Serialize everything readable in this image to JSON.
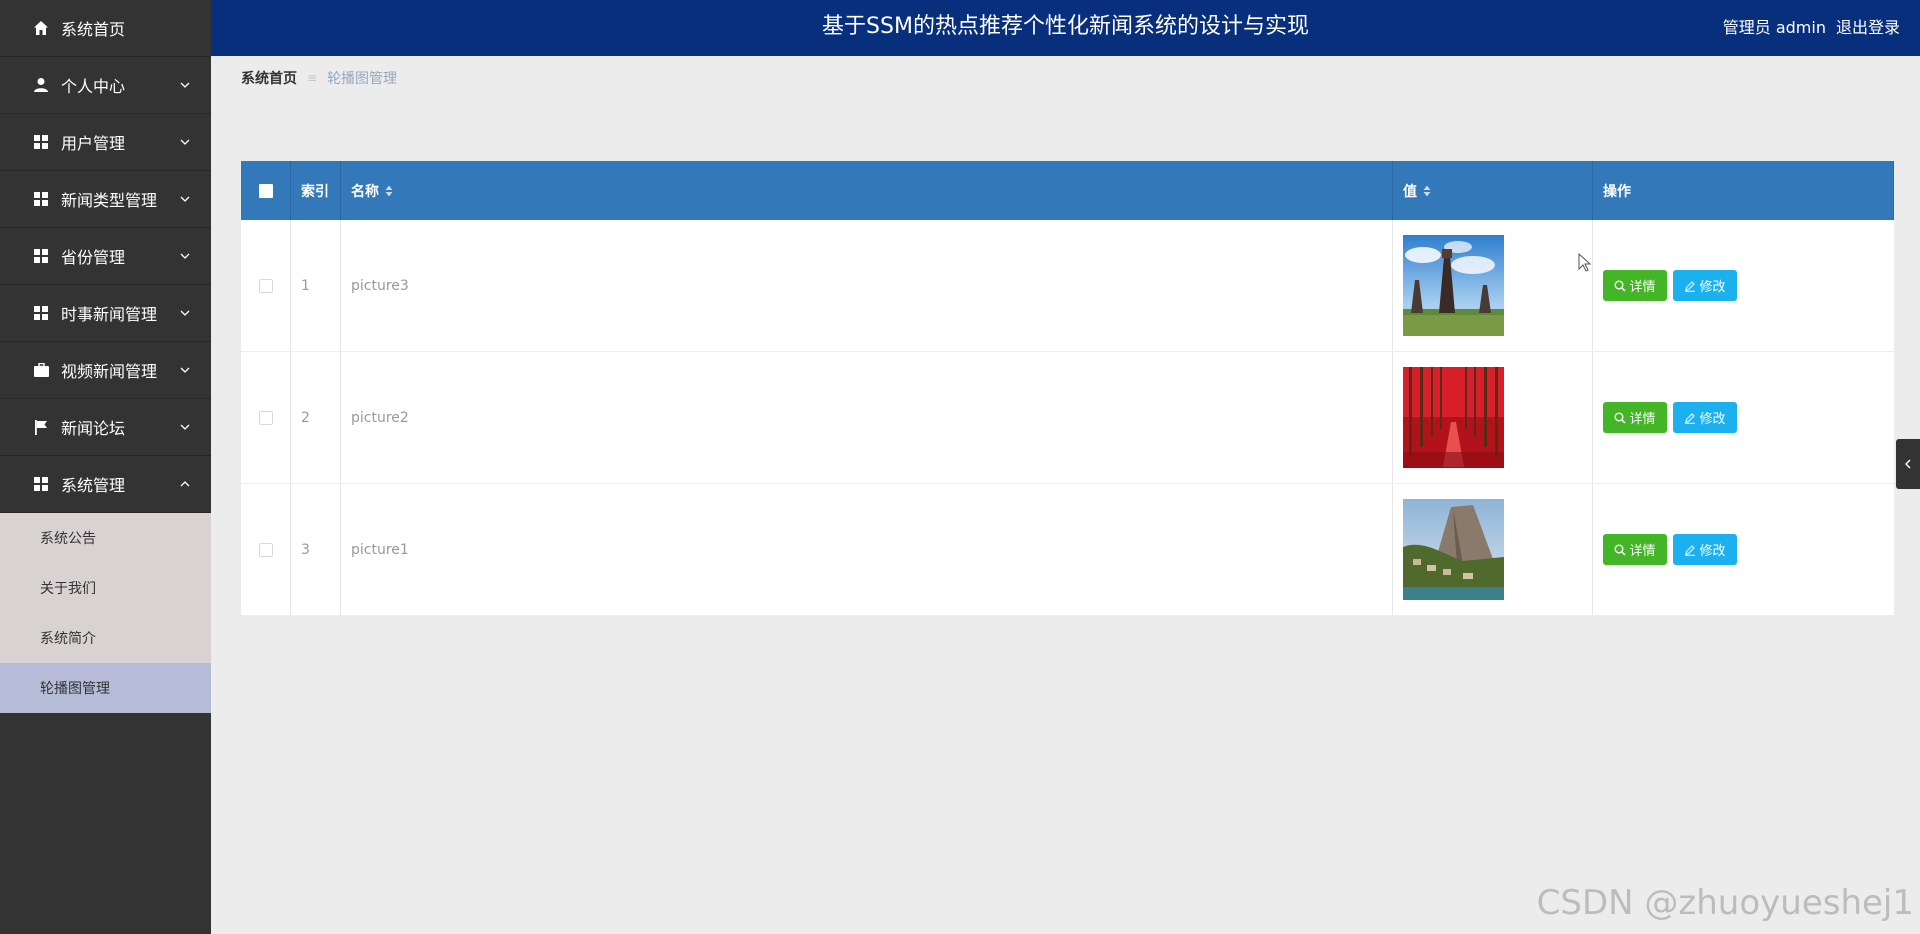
{
  "app": {
    "title": "基于SSM的热点推荐个性化新闻系统的设计与实现"
  },
  "header": {
    "user_label": "管理员 admin",
    "logout_label": "退出登录"
  },
  "sidebar": {
    "items": [
      {
        "label": "系统首页",
        "icon": "home-icon"
      },
      {
        "label": "个人中心",
        "icon": "user-icon"
      },
      {
        "label": "用户管理",
        "icon": "grid-icon"
      },
      {
        "label": "新闻类型管理",
        "icon": "grid-icon"
      },
      {
        "label": "省份管理",
        "icon": "grid-icon"
      },
      {
        "label": "时事新闻管理",
        "icon": "grid-icon"
      },
      {
        "label": "视频新闻管理",
        "icon": "briefcase-icon"
      },
      {
        "label": "新闻论坛",
        "icon": "flag-icon"
      },
      {
        "label": "系统管理",
        "icon": "grid-icon"
      }
    ],
    "submenu": [
      {
        "label": "系统公告"
      },
      {
        "label": "关于我们"
      },
      {
        "label": "系统简介"
      },
      {
        "label": "轮播图管理"
      }
    ]
  },
  "breadcrumb": {
    "home": "系统首页",
    "separator": "≡",
    "current": "轮播图管理"
  },
  "table": {
    "columns": {
      "index": "索引",
      "name": "名称",
      "value": "值",
      "actions": "操作"
    },
    "rows": [
      {
        "index": "1",
        "name": "picture3",
        "thumb": "lighthouses"
      },
      {
        "index": "2",
        "name": "picture2",
        "thumb": "red-forest"
      },
      {
        "index": "3",
        "name": "picture1",
        "thumb": "cliff-village"
      }
    ],
    "detail_label": "详情",
    "edit_label": "修改"
  },
  "watermark": "CSDN @zhuoyueshej1",
  "colors": {
    "header_bg": "#082f7c",
    "sidebar_bg": "#333333",
    "table_header_bg": "#3378b8",
    "detail_button": "#43b527",
    "edit_button": "#1bb1ee",
    "active_submenu_bg": "#b6bcd8"
  }
}
